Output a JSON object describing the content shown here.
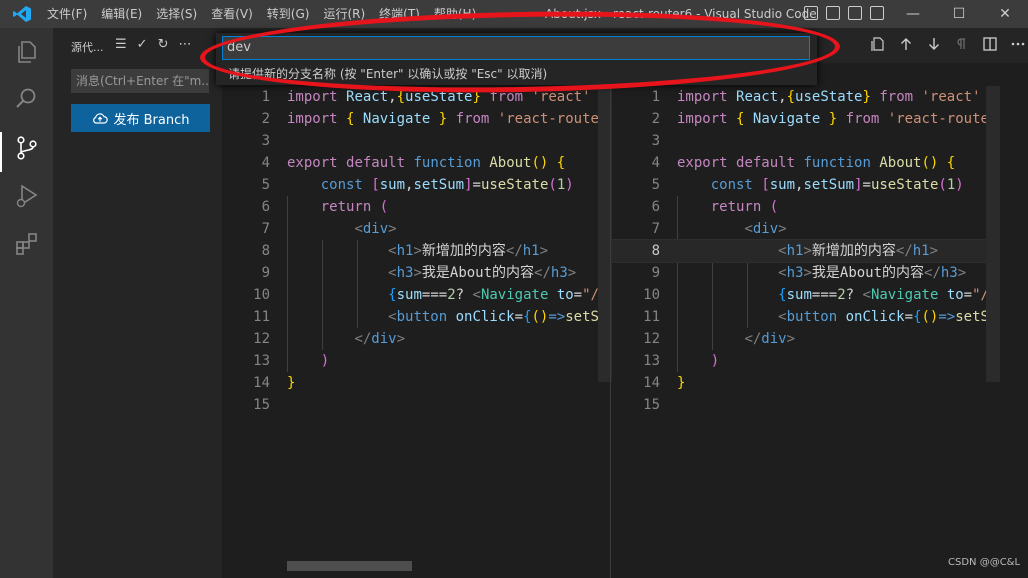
{
  "window": {
    "title": "About.jsx - react-router6 - Visual Studio Code",
    "menu": [
      "文件(F)",
      "编辑(E)",
      "选择(S)",
      "查看(V)",
      "转到(G)",
      "运行(R)",
      "终端(T)",
      "帮助(H)"
    ],
    "controls": {
      "minimize": "—",
      "maximize": "☐",
      "close": "✕"
    }
  },
  "activity_bar": [
    "explorer-icon",
    "search-icon",
    "source-control-icon",
    "run-debug-icon",
    "extensions-icon"
  ],
  "sidebar": {
    "title": "源代...",
    "actions": [
      "☰",
      "✓",
      "↻",
      "⋯"
    ],
    "message_placeholder": "消息(Ctrl+Enter 在\"m...",
    "publish_label": "发布 Branch"
  },
  "quick_input": {
    "value": "dev",
    "message": "请提供新的分支名称 (按 \"Enter\" 以确认或按 \"Esc\" 以取消)"
  },
  "editor": {
    "highlighted_line_right": 8,
    "line_numbers": [
      "1",
      "2",
      "3",
      "4",
      "5",
      "6",
      "7",
      "8",
      "9",
      "10",
      "11",
      "12",
      "13",
      "14",
      "15"
    ]
  },
  "watermark": "CSDN @@C&L",
  "colors": {
    "accent": "#007acc",
    "button": "#0e639c",
    "annotation": "#e8141b"
  }
}
